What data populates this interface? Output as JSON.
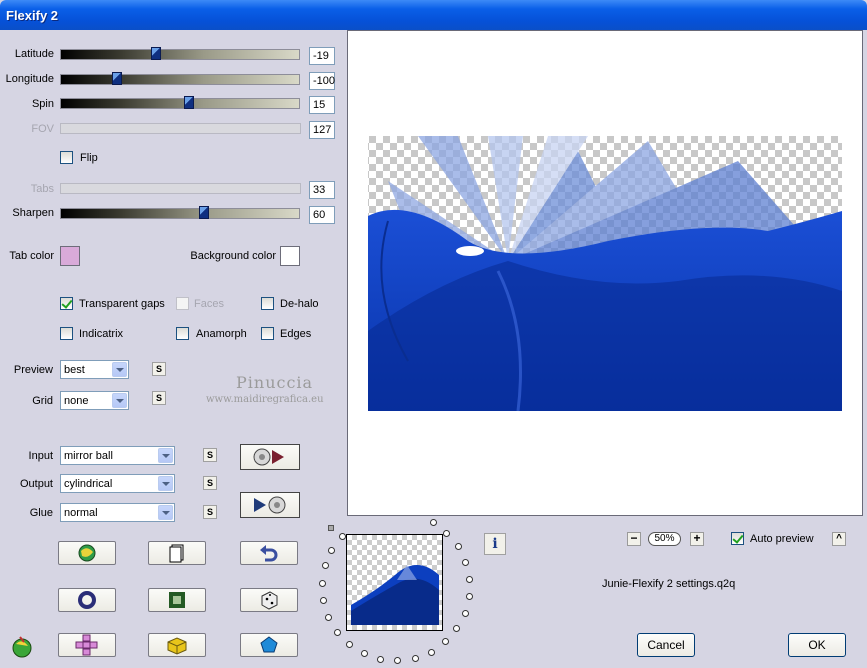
{
  "window": {
    "title": "Flexify 2"
  },
  "sliders": [
    {
      "label": "Latitude",
      "value": "-19",
      "disabled": false,
      "pos": 0.4
    },
    {
      "label": "Longitude",
      "value": "-100",
      "disabled": false,
      "pos": 0.23
    },
    {
      "label": "Spin",
      "value": "15",
      "disabled": false,
      "pos": 0.52
    },
    {
      "label": "FOV",
      "value": "127",
      "disabled": true
    },
    {
      "label": "Tabs",
      "value": "33",
      "disabled": true
    },
    {
      "label": "Sharpen",
      "value": "60",
      "disabled": false,
      "pos": 0.58
    }
  ],
  "flip": {
    "label": "Flip",
    "checked": false
  },
  "colors": {
    "tab_color_label": "Tab color",
    "tab_color": "#d9aad9",
    "background_color_label": "Background color",
    "background_color": "#ffffff"
  },
  "options": {
    "transparent_gaps": {
      "label": "Transparent gaps",
      "checked": true
    },
    "faces": {
      "label": "Faces",
      "checked": false
    },
    "de_halo": {
      "label": "De-halo",
      "checked": false
    },
    "indicatrix": {
      "label": "Indicatrix",
      "checked": false
    },
    "anamorph": {
      "label": "Anamorph",
      "checked": false
    },
    "edges": {
      "label": "Edges",
      "checked": false
    }
  },
  "preview_select": {
    "label": "Preview",
    "value": "best"
  },
  "grid_select": {
    "label": "Grid",
    "value": "none"
  },
  "watermark": {
    "line1": "Pinuccia",
    "line2": "www.maidiregrafica.eu"
  },
  "input_select": {
    "label": "Input",
    "value": "mirror ball"
  },
  "output_select": {
    "label": "Output",
    "value": "cylindrical"
  },
  "glue_select": {
    "label": "Glue",
    "value": "normal"
  },
  "s_button": "S",
  "zoom": {
    "value": "50%",
    "minus": "−",
    "plus": "+"
  },
  "auto_preview": {
    "label": "Auto preview",
    "checked": true,
    "collapse": "^"
  },
  "info_button": "i",
  "settings_file": "Junie-Flexify 2 settings.q2q",
  "buttons": {
    "cancel": "Cancel",
    "ok": "OK"
  },
  "accent": {
    "titlebar": "#0a5fe8",
    "preview_blue": "#0c3fbf"
  }
}
